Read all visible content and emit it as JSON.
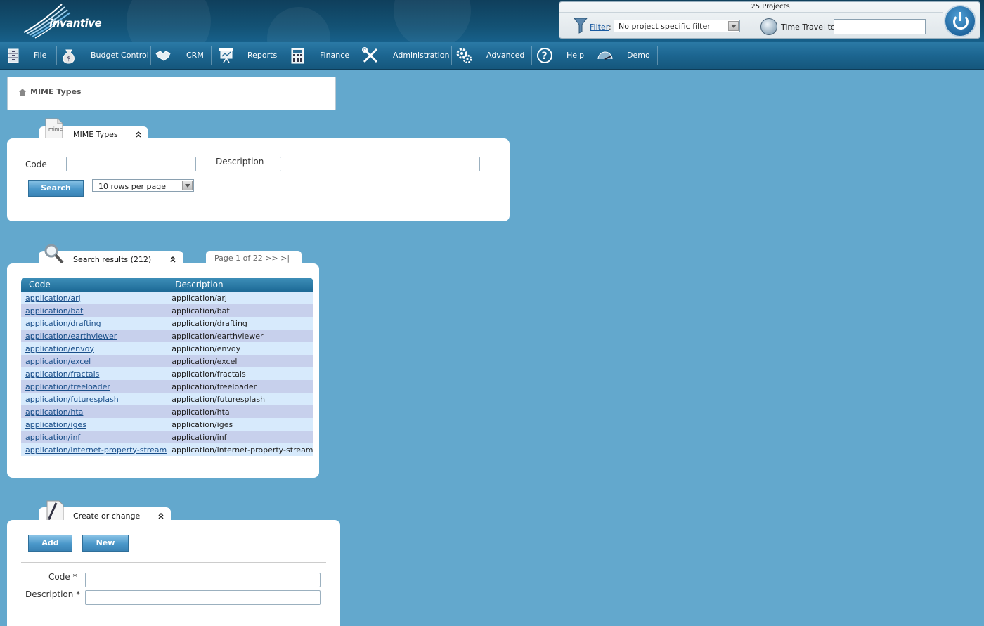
{
  "header": {
    "logo_text": "invantive",
    "projects_label": "25 Projects",
    "filter_link": "Filter",
    "filter_colon": ":",
    "filter_select_value": "No project specific filter",
    "time_travel_label": "Time Travel to:",
    "time_travel_value": ""
  },
  "menu": {
    "items": [
      {
        "label": "File",
        "icon": "file-cabinet-icon"
      },
      {
        "label": "Budget Control",
        "icon": "money-bag-icon"
      },
      {
        "label": "CRM",
        "icon": "handshake-icon"
      },
      {
        "label": "Reports",
        "icon": "presentation-board-icon"
      },
      {
        "label": "Finance",
        "icon": "calculator-icon"
      },
      {
        "label": "Administration",
        "icon": "tools-icon"
      },
      {
        "label": "Advanced",
        "icon": "gears-icon"
      },
      {
        "label": "Help",
        "icon": "question-icon"
      },
      {
        "label": "Demo",
        "icon": "gauge-icon"
      }
    ]
  },
  "breadcrumb": {
    "label": "MIME Types"
  },
  "search_panel": {
    "title": "MIME Types",
    "icon_text": "mime",
    "code_label": "Code",
    "code_value": "",
    "description_label": "Description",
    "description_value": "",
    "search_button": "Search",
    "rows_per_page": "10 rows per page"
  },
  "results_panel": {
    "title": "Search results (212)",
    "pager": "Page 1 of 22  >>  >|",
    "columns": [
      "Code",
      "Description"
    ],
    "rows": [
      {
        "code": "application/arj",
        "description": "application/arj"
      },
      {
        "code": "application/bat",
        "description": "application/bat"
      },
      {
        "code": "application/drafting",
        "description": "application/drafting"
      },
      {
        "code": "application/earthviewer",
        "description": "application/earthviewer"
      },
      {
        "code": "application/envoy",
        "description": "application/envoy"
      },
      {
        "code": "application/excel",
        "description": "application/excel"
      },
      {
        "code": "application/fractals",
        "description": "application/fractals"
      },
      {
        "code": "application/freeloader",
        "description": "application/freeloader"
      },
      {
        "code": "application/futuresplash",
        "description": "application/futuresplash"
      },
      {
        "code": "application/hta",
        "description": "application/hta"
      },
      {
        "code": "application/iges",
        "description": "application/iges"
      },
      {
        "code": "application/inf",
        "description": "application/inf"
      },
      {
        "code": "application/internet-property-stream",
        "description": "application/internet-property-stream"
      }
    ]
  },
  "create_panel": {
    "title": "Create or change",
    "add_button": "Add",
    "new_button": "New",
    "code_label": "Code *",
    "code_value": "",
    "description_label": "Description *",
    "description_value": ""
  },
  "colors": {
    "background": "#63a8cd",
    "header_dark": "#0f3f5c",
    "menubar": "#1c6590",
    "button_blue": "#4a97c9",
    "row_odd": "#d7eafc",
    "row_even": "#c7d0ec",
    "link": "#1a4f8a"
  }
}
